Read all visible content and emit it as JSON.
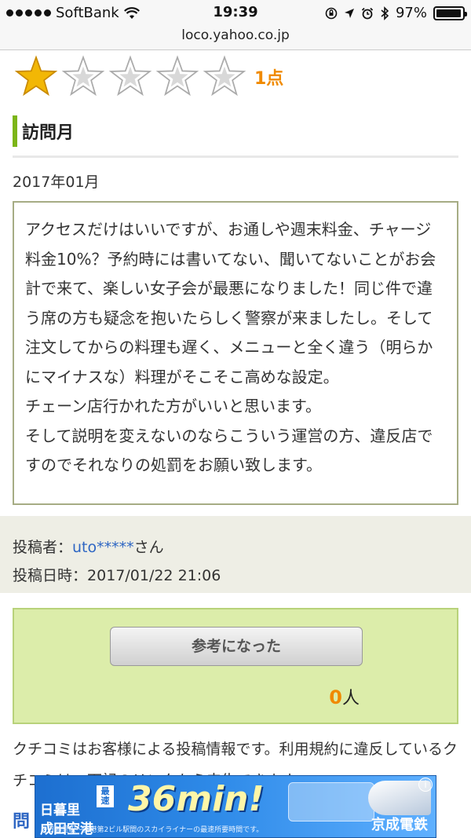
{
  "status_bar": {
    "carrier": "SoftBank",
    "time": "19:39",
    "battery_percent": "97%",
    "battery_level": 0.97
  },
  "url": "loco.yahoo.co.jp",
  "rating": {
    "score": 1,
    "max": 5,
    "score_label": "1点",
    "star_filled_color": "#f2b705",
    "star_empty_color": "#d8d8d8"
  },
  "section": {
    "title": "訪問月",
    "accent_color": "#7cb518"
  },
  "visit_date": "2017年01月",
  "review_text": "アクセスだけはいいですが、お通しや週末料金、チャージ料金10%？予約時には書いてない、聞いてないことがお会計で来て、楽しい女子会が最悪になりました！同じ件で違う席の方も疑念を抱いたらしく警察が来ましたし。そして注文してからの料理も遅く、メニューと全く違う（明らかにマイナスな）料理がそこそこ高めな設定。\nチェーン店行かれた方がいいと思います。\nそして説明を変えないのならこういう運営の方、違反店ですのでそれなりの処罰をお願い致します。",
  "poster": {
    "label": "投稿者：",
    "name": "uto*****",
    "suffix": "さん",
    "date_label": "投稿日時：",
    "date": "2017/01/22 21:06"
  },
  "helpful": {
    "button_label": "参考になった",
    "count": "0",
    "unit": "人"
  },
  "notice_text": "クチコミはお客様による投稿情報です。利用規約に違反しているクチコミは、下記のリンクから申告できます。",
  "more_heading": "問",
  "ad": {
    "left_text": "日暮里\n成田空港",
    "tag": "最速",
    "headline": "36min!",
    "small_text": "※日暮里駅〜空港第2ビル駅間のスカイライナーの最速所要時間です。",
    "brand": "京成電鉄"
  }
}
